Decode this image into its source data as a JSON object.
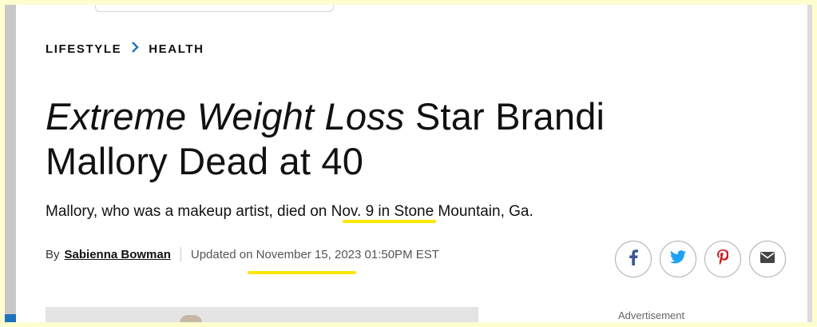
{
  "breadcrumb": {
    "section": "LIFESTYLE",
    "separator": "›",
    "subsection": "HEALTH"
  },
  "headline": {
    "italic_part": "Extreme Weight Loss",
    "rest_line1": " Star Brandi",
    "rest_line2": "Mallory Dead at 40"
  },
  "dek": "Mallory, who was a makeup artist, died on Nov. 9 in Stone Mountain, Ga.",
  "byline": {
    "prefix": "By",
    "author": "Sabienna Bowman",
    "updated": "Updated on November 15, 2023 01:50PM EST"
  },
  "share_buttons": [
    {
      "network": "facebook",
      "icon": "facebook-icon",
      "color": "#3b5998"
    },
    {
      "network": "twitter",
      "icon": "twitter-icon",
      "color": "#1da1f2"
    },
    {
      "network": "pinterest",
      "icon": "pinterest-icon",
      "color": "#cb2027"
    },
    {
      "network": "email",
      "icon": "email-icon",
      "color": "#444444"
    }
  ],
  "advertisement_label": "Advertisement",
  "colors": {
    "highlight": "#ffe600",
    "breadcrumb_separator": "#1e73be",
    "page_background": "#fdfdd0"
  }
}
